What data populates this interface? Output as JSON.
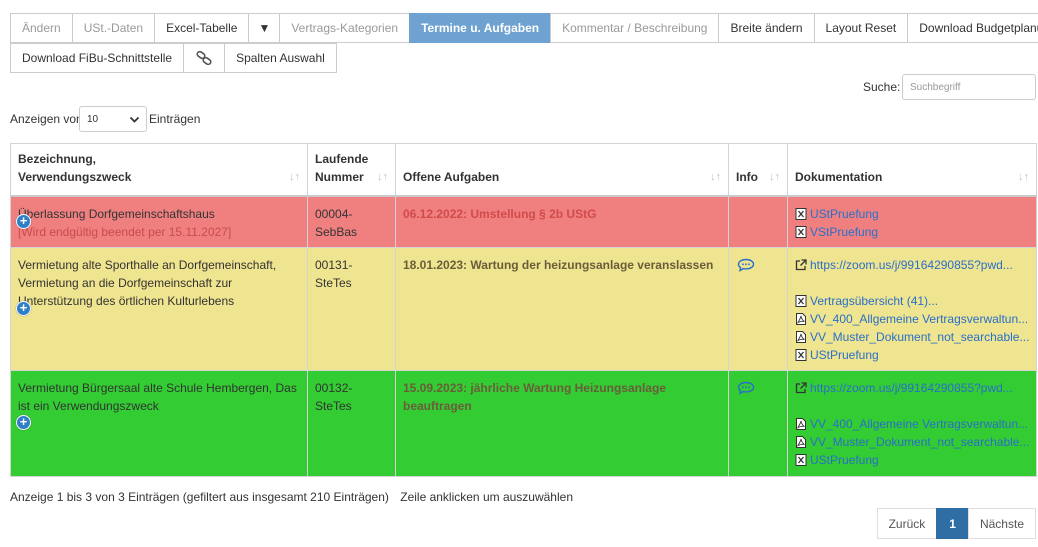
{
  "toolbar": {
    "row1": [
      {
        "label": "Ändern",
        "muted": true
      },
      {
        "label": "USt.-Daten",
        "muted": true
      },
      {
        "label": "Excel-Tabelle",
        "muted": false
      },
      {
        "label": "▼",
        "muted": false
      },
      {
        "label": "Vertrags-Kategorien",
        "muted": true
      },
      {
        "label": "Termine u. Aufgaben",
        "active": true
      },
      {
        "label": "Kommentar / Beschreibung",
        "muted": true
      },
      {
        "label": "Breite ändern",
        "muted": false
      },
      {
        "label": "Layout Reset",
        "muted": false
      },
      {
        "label": "Download Budgetplanung",
        "muted": false
      }
    ],
    "row2": [
      {
        "label": "Download FiBu-Schnittstelle"
      },
      {
        "label": "",
        "icon": "link-icon"
      },
      {
        "label": "Spalten Auswahl"
      }
    ]
  },
  "search": {
    "label": "Suche:",
    "placeholder": "Suchbegriff",
    "value": ""
  },
  "length": {
    "prefix": "Anzeigen von",
    "value": "10",
    "suffix": "Einträgen"
  },
  "table": {
    "headers": [
      {
        "line1": "Bezeichnung,",
        "line2": "Verwendungszweck"
      },
      {
        "line1": "Laufende",
        "line2": "Nummer"
      },
      {
        "line1": "",
        "line2": "Offene Aufgaben"
      },
      {
        "line1": "",
        "line2": "Info"
      },
      {
        "line1": "",
        "line2": "Dokumentation"
      }
    ],
    "rows": [
      {
        "color": "red",
        "title": "Überlassung Dorfgemeinschaftshaus",
        "subtitle": "[Wird endgültig beendet per 15.11.2027]",
        "number": "00004-SebBas",
        "task": "06.12.2022: Umstellung § 2b UStG",
        "info": false,
        "docs": [
          {
            "type": "excel",
            "label": "UStPruefung",
            "gap": false
          },
          {
            "type": "excel",
            "label": "VStPruefung",
            "gap": false
          }
        ]
      },
      {
        "color": "yellow",
        "title": "Vermietung alte Sporthalle an Dorfgemeinschaft, Vermietung an die Dorfgemeinschaft zur Unterstützung des örtlichen Kulturlebens",
        "subtitle": "",
        "number": "00131-SteTes",
        "task": "18.01.2023: Wartung der heizungsanlage veranslassen",
        "info": true,
        "docs": [
          {
            "type": "link",
            "label": "https://zoom.us/j/99164290855?pwd...",
            "gap": false
          },
          {
            "type": "excel",
            "label": "Vertragsübersicht (41)...",
            "gap": true
          },
          {
            "type": "pdf",
            "label": "VV_400_Allgemeine Vertragsverwaltun...",
            "gap": false
          },
          {
            "type": "pdf",
            "label": "VV_Muster_Dokument_not_searchable...",
            "gap": false
          },
          {
            "type": "excel",
            "label": "UStPruefung",
            "gap": false
          }
        ]
      },
      {
        "color": "green",
        "title": "Vermietung Bürgersaal alte Schule Hembergen, Das ist ein Verwendungszweck",
        "subtitle": "",
        "number": "00132-SteTes",
        "task": "15.09.2023: jährliche Wartung Heizungsanlage beauftragen",
        "info": true,
        "docs": [
          {
            "type": "link",
            "label": "https://zoom.us/j/99164290855?pwd...",
            "gap": false
          },
          {
            "type": "pdf",
            "label": "VV_400_Allgemeine Vertragsverwaltun...",
            "gap": true
          },
          {
            "type": "pdf",
            "label": "VV_Muster_Dokument_not_searchable...",
            "gap": false
          },
          {
            "type": "excel",
            "label": "UStPruefung",
            "gap": false
          }
        ]
      }
    ]
  },
  "footer": {
    "info": "Anzeige 1 bis 3 von 3 Einträgen (gefiltert aus insgesamt 210 Einträgen)",
    "hint": "Zeile anklicken um auszuwählen"
  },
  "pagination": {
    "prev": "Zurück",
    "current": "1",
    "next": "Nächste"
  },
  "colors": {
    "red": "#f08080",
    "yellow": "#efe48f",
    "green": "#33cc33",
    "active": "#6fa2d0",
    "link": "#2a6fc9"
  }
}
